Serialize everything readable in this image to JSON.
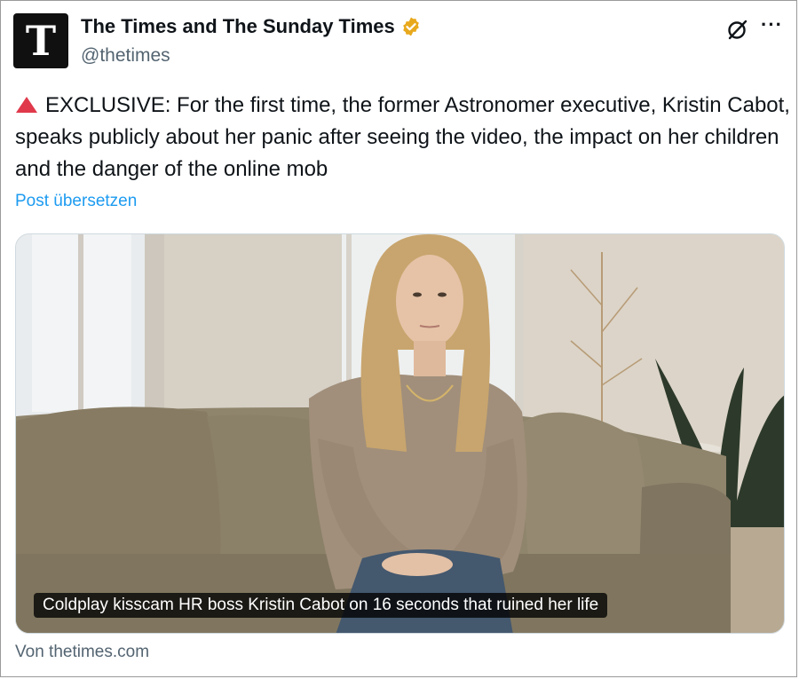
{
  "account": {
    "display_name": "The Times and The Sunday Times",
    "handle": "@thetimes",
    "avatar_letter": "T",
    "verified": true,
    "verified_color": "#e8a91d"
  },
  "header_actions": {
    "grok_icon": "grok-icon",
    "more_icon": "more-icon",
    "more_glyph": "···"
  },
  "post": {
    "text": "EXCLUSIVE: For the first time, the former Astronomer executive, Kristin Cabot, speaks publicly about her panic after seeing the video, the impact on her children and the danger of the online mob",
    "translate_label": "Post übersetzen",
    "leading_icon": "red-triangle-icon",
    "link_color": "#1d9bf0"
  },
  "media": {
    "caption": "Coldplay kisscam HR boss Kristin Cabot on 16 seconds that ruined her life"
  },
  "card_source": "Von thetimes.com"
}
